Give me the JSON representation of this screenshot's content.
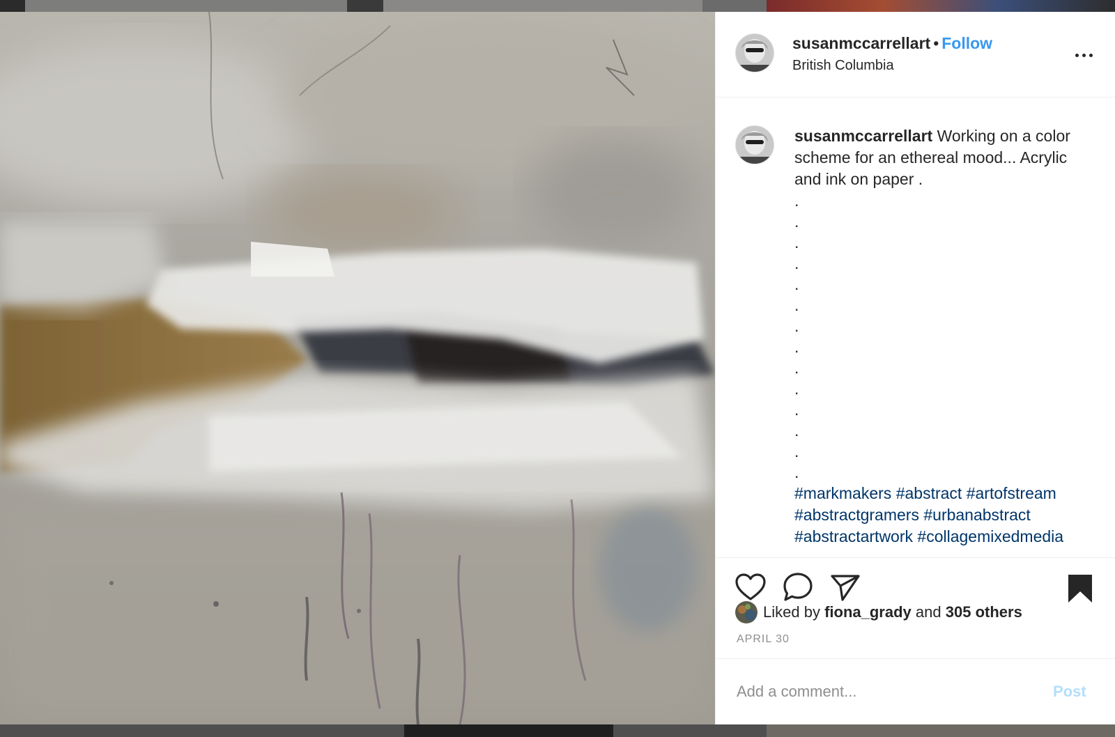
{
  "post": {
    "author": "susanmccarrellart",
    "separator": "•",
    "follow_label": "Follow",
    "location": "British Columbia",
    "caption_text": "Working on a color scheme for an ethereal mood... Acrylic and ink on paper .",
    "caption_dots": [
      ".",
      ".",
      ".",
      ".",
      ".",
      ".",
      ".",
      ".",
      ".",
      ".",
      ".",
      ".",
      ".",
      "."
    ],
    "hashtags": [
      "#markmakers",
      "#abstract",
      "#artofstream",
      "#abstractgramers",
      "#urbanabstract",
      "#abstractartwork",
      "#collagemixedmedia"
    ],
    "liked_by_prefix": "Liked by",
    "liked_by_user": "fiona_grady",
    "liked_by_and": "and",
    "liked_by_others": "305 others",
    "date": "APRIL 30"
  },
  "comment": {
    "placeholder": "Add a comment...",
    "post_label": "Post"
  },
  "icons": {
    "more": "more-options-icon",
    "like": "heart-icon",
    "comment": "comment-icon",
    "share": "share-icon",
    "save": "bookmark-icon"
  },
  "colors": {
    "link": "#3897f0",
    "hashtag": "#003569",
    "post_disabled": "#b2dffc",
    "muted": "#8e8e8e"
  }
}
